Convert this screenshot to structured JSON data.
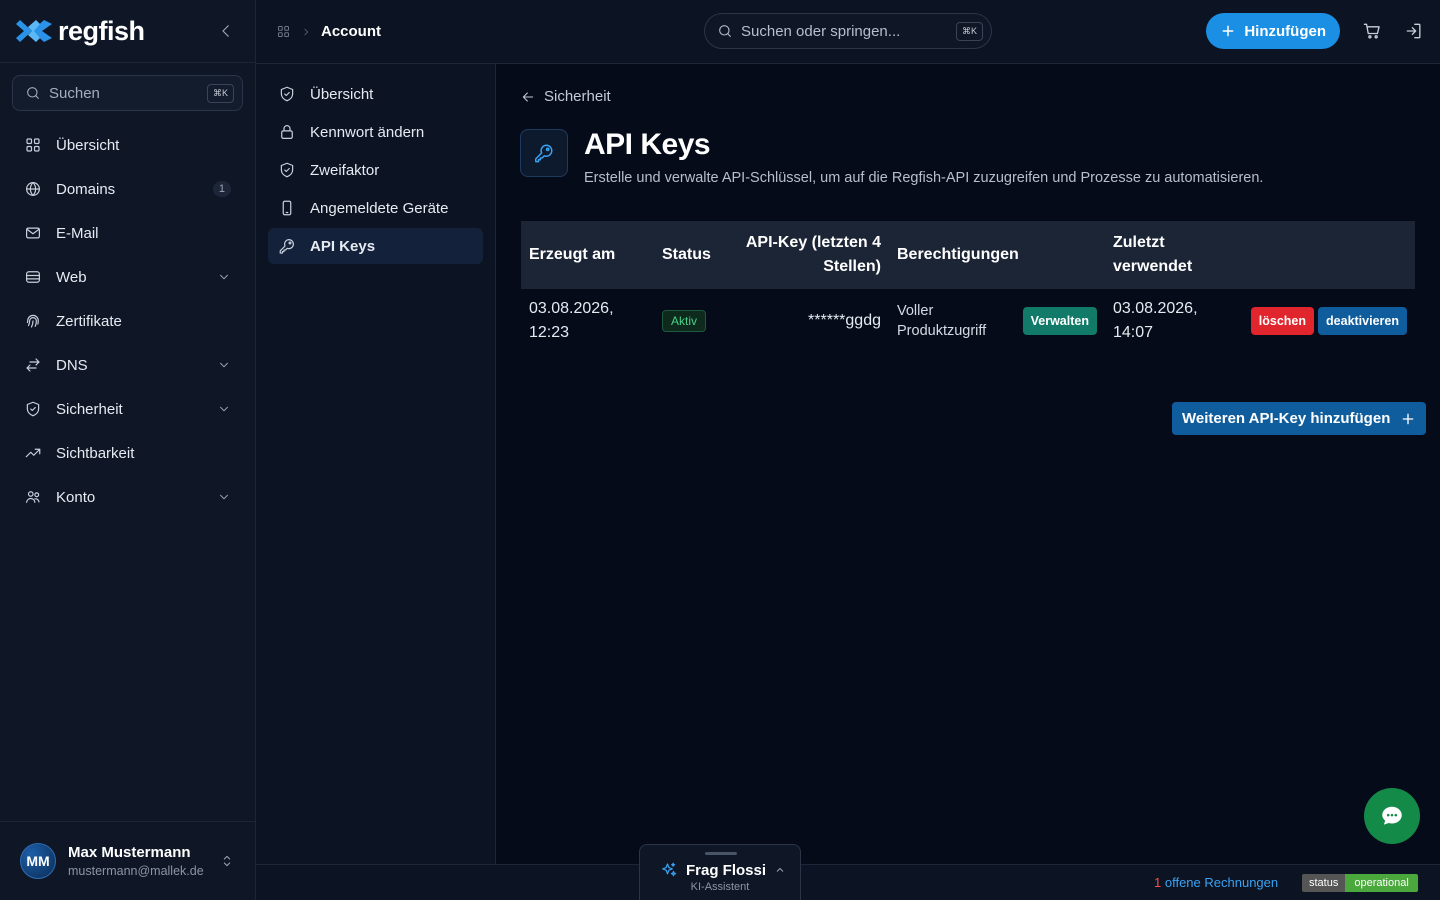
{
  "brand": {
    "name": "regfish"
  },
  "sidebar": {
    "search": {
      "label": "Suchen",
      "shortcut": "⌘K"
    },
    "items": [
      {
        "label": "Übersicht"
      },
      {
        "label": "Domains",
        "count": "1"
      },
      {
        "label": "E-Mail"
      },
      {
        "label": "Web"
      },
      {
        "label": "Zertifikate"
      },
      {
        "label": "DNS"
      },
      {
        "label": "Sicherheit"
      },
      {
        "label": "Sichtbarkeit"
      },
      {
        "label": "Konto"
      }
    ],
    "user": {
      "initials": "MM",
      "name": "Max Mustermann",
      "email": "mustermann@mallek.de"
    }
  },
  "topbar": {
    "breadcrumb": "Account",
    "search": {
      "placeholder": "Suchen oder springen...",
      "shortcut": "⌘K"
    },
    "add_label": "Hinzufügen"
  },
  "subnav": {
    "items": [
      {
        "label": "Übersicht"
      },
      {
        "label": "Kennwort ändern"
      },
      {
        "label": "Zweifaktor"
      },
      {
        "label": "Angemeldete Geräte"
      },
      {
        "label": "API Keys"
      }
    ],
    "active": "API Keys"
  },
  "main": {
    "back_label": "Sicherheit",
    "title": "API Keys",
    "description": "Erstelle und verwalte API-Schlüssel, um auf die Regfish-API zuzugreifen und Prozesse zu automatisieren.",
    "table": {
      "headers": {
        "created": "Erzeugt am",
        "status": "Status",
        "key": "API-Key (letzten 4 Stellen)",
        "permissions": "Berechtigungen",
        "last_used": "Zuletzt verwendet"
      },
      "rows": [
        {
          "created": "03.08.2026, 12:23",
          "status": "Aktiv",
          "key": "******ggdg",
          "permissions": "Voller Produktzugriff",
          "manage_label": "Verwalten",
          "last_used": "03.08.2026, 14:07",
          "delete_label": "löschen",
          "deactivate_label": "deaktivieren"
        }
      ]
    },
    "add_more_label": "Weiteren API-Key hinzufügen"
  },
  "assistant": {
    "title": "Frag Flossi",
    "subtitle": "KI-Assistent"
  },
  "footer": {
    "invoices_count": "1",
    "invoices_label": "offene Rechnungen",
    "status_key": "status",
    "status_value": "operational"
  },
  "colors": {
    "background": "#050b18",
    "panel": "#0f1727",
    "accent": "#1a8fe3",
    "status_active": "#4ad08a",
    "manage": "#117a69",
    "danger": "#e0262c",
    "secondary": "#0f5d9d",
    "chat": "#148a48"
  }
}
